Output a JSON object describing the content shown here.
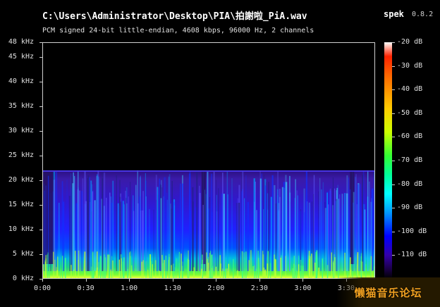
{
  "header": {
    "file_path": "C:\\Users\\Administrator\\Desktop\\PIA\\拍謝啦_PiA.wav",
    "app_name": "spek",
    "app_version": "0.8.2",
    "file_info": "PCM signed 24-bit little-endian, 4608 kbps, 96000 Hz, 2 channels"
  },
  "chart_data": {
    "type": "heatmap",
    "title": "",
    "xlabel": "",
    "ylabel": "",
    "x_ticks": [
      "0:00",
      "0:30",
      "1:00",
      "1:30",
      "2:00",
      "2:30",
      "3:00",
      "3:30"
    ],
    "x_tick_seconds": [
      0,
      30,
      60,
      90,
      120,
      150,
      180,
      210
    ],
    "xlim": [
      0,
      230
    ],
    "y_ticks": [
      "0 kHz",
      "5 kHz",
      "10 kHz",
      "15 kHz",
      "20 kHz",
      "25 kHz",
      "30 kHz",
      "35 kHz",
      "40 kHz",
      "45 kHz",
      "48 kHz"
    ],
    "y_tick_khz": [
      0,
      5,
      10,
      15,
      20,
      25,
      30,
      35,
      40,
      45,
      48
    ],
    "ylim": [
      0,
      48
    ],
    "colorbar_ticks": [
      "-20 dB",
      "-30 dB",
      "-40 dB",
      "-50 dB",
      "-60 dB",
      "-70 dB",
      "-80 dB",
      "-90 dB",
      "-100 dB",
      "-110 dB"
    ],
    "colorbar_db": [
      -20,
      -30,
      -40,
      -50,
      -60,
      -70,
      -80,
      -90,
      -100,
      -110
    ],
    "colorbar_range": [
      -120,
      -20
    ],
    "content_cutoff_khz": 22,
    "quiet_segments_seconds": [
      [
        0,
        8
      ],
      [
        110,
        113
      ],
      [
        213,
        216
      ]
    ]
  },
  "watermark": {
    "text": "懒猫音乐论坛"
  },
  "colors": {
    "background": "#000000",
    "text": "#e8e8e8",
    "accent_watermark": "#f0a020"
  }
}
